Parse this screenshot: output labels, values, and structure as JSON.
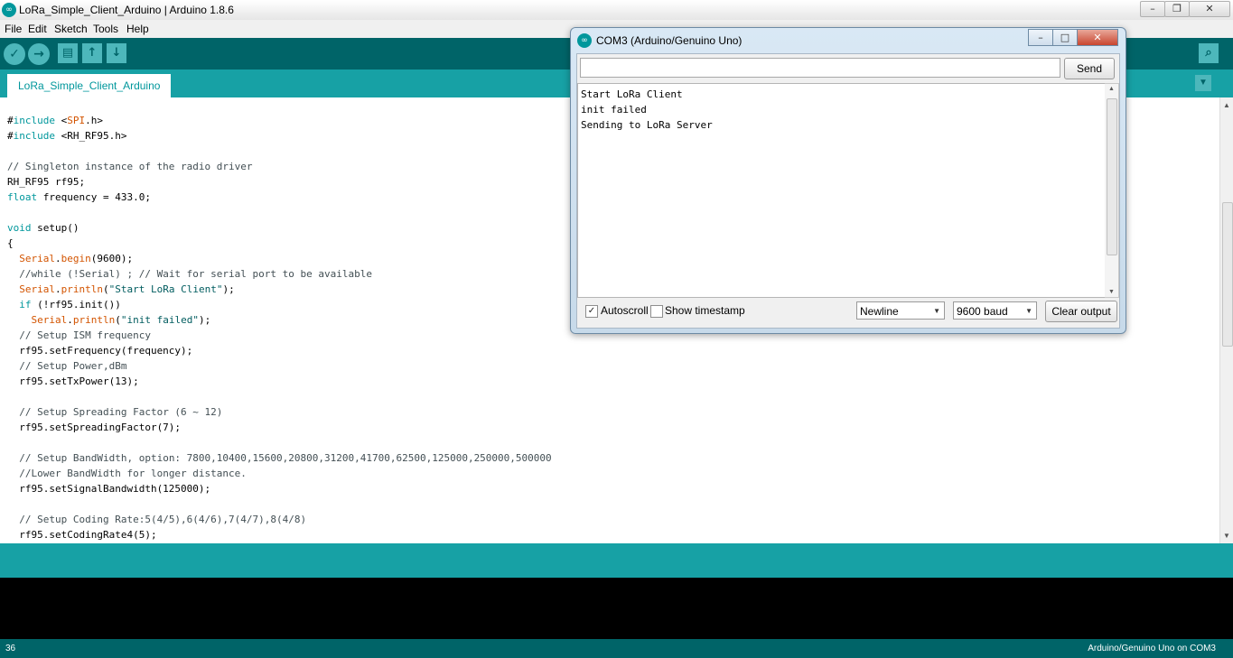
{
  "window": {
    "title": "LoRa_Simple_Client_Arduino | Arduino 1.8.6",
    "logo": "∞"
  },
  "menu": [
    "File",
    "Edit",
    "Sketch",
    "Tools",
    "Help"
  ],
  "toolbar": {
    "verify_icon": "✓",
    "upload_icon": "→",
    "new_icon": "▤",
    "open_icon": "↑",
    "save_icon": "↓",
    "serial_icon": "⌕"
  },
  "tab": {
    "label": "LoRa_Simple_Client_Arduino",
    "menu_icon": "▼"
  },
  "editor": {
    "lines": [
      "#include <SPI.h>",
      "#include <RH_RF95.h>",
      "",
      "// Singleton instance of the radio driver",
      "RH_RF95 rf95;",
      "float frequency = 433.0;",
      "",
      "void setup()",
      "{",
      "  Serial.begin(9600);",
      "  //while (!Serial) ; // Wait for serial port to be available",
      "  Serial.println(\"Start LoRa Client\");",
      "  if (!rf95.init())",
      "    Serial.println(\"init failed\");",
      "  // Setup ISM frequency",
      "  rf95.setFrequency(frequency);",
      "  // Setup Power,dBm",
      "  rf95.setTxPower(13);",
      "",
      "  // Setup Spreading Factor (6 ~ 12)",
      "  rf95.setSpreadingFactor(7);",
      "",
      "  // Setup BandWidth, option: 7800,10400,15600,20800,31200,41700,62500,125000,250000,500000",
      "  //Lower BandWidth for longer distance.",
      "  rf95.setSignalBandwidth(125000);",
      "",
      "  // Setup Coding Rate:5(4/5),6(4/6),7(4/7),8(4/8)",
      "  rf95.setCodingRate4(5);"
    ]
  },
  "status": {
    "line_number": "36",
    "board": "Arduino/Genuino Uno on COM3"
  },
  "serial_monitor": {
    "title": "COM3 (Arduino/Genuino Uno)",
    "send_input_value": "",
    "send_label": "Send",
    "output_lines": [
      "Start LoRa Client",
      "init failed",
      "Sending to LoRa Server"
    ],
    "autoscroll_label": "Autoscroll",
    "autoscroll_checked": true,
    "timestamp_label": "Show timestamp",
    "timestamp_checked": false,
    "line_ending": "Newline",
    "baud": "9600 baud",
    "clear_label": "Clear output"
  },
  "colors": {
    "toolbar": "#006468",
    "tabbar": "#17a1a5",
    "keyword": "#00979c",
    "function": "#d35400"
  }
}
